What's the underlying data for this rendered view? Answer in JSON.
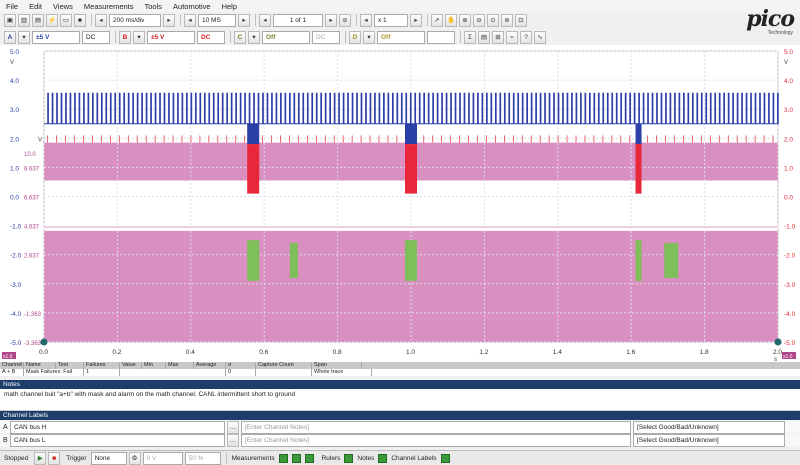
{
  "menu": [
    "File",
    "Edit",
    "Views",
    "Measurements",
    "Tools",
    "Automotive",
    "Help"
  ],
  "logo": {
    "word": "pico",
    "sub": "Technology"
  },
  "toolbar": {
    "timebase": "200 ms/div",
    "samples": "10 MS",
    "buffer": "1 of 1",
    "zoom": "x 1"
  },
  "channels": {
    "a": {
      "label": "A",
      "range": "±5 V",
      "coupling": "DC"
    },
    "b": {
      "label": "B",
      "range": "±5 V",
      "coupling": "DC"
    },
    "c": {
      "label": "C",
      "state": "Off"
    },
    "d": {
      "label": "D",
      "state": "Off"
    },
    "c_coupling": "DC"
  },
  "scope": {
    "left_axis_a": [
      "5.0",
      "4.0",
      "3.0",
      "2.0",
      "1.0",
      "0.0",
      "-1.0",
      "-2.0",
      "-3.0",
      "-4.0",
      "-5.0"
    ],
    "left_axis_math": [
      "10.0",
      "8.637",
      "6.637",
      "4.637",
      "2.637",
      "-1.363",
      "-3.363"
    ],
    "right_axis": [
      "5.0",
      "4.0",
      "3.0",
      "2.0",
      "1.0",
      "0.0",
      "-1.0",
      "-2.0",
      "-3.0",
      "-4.0",
      "-5.0"
    ],
    "unit_v": "V",
    "x_axis": [
      "0.0",
      "0.2",
      "0.4",
      "0.6",
      "0.8",
      "1.0",
      "1.2",
      "1.4",
      "1.6",
      "1.8",
      "2.0"
    ],
    "x_unit": "s",
    "ruler_left": "x1.0",
    "ruler_right": "x1.0"
  },
  "measurements": {
    "headers": [
      "Channel",
      "Name",
      "Test",
      "Failures",
      "Value",
      "Min",
      "Max",
      "Average",
      "σ",
      "Capture Count",
      "Span"
    ],
    "row": [
      "A + B",
      "Mask Failures: Fail",
      "",
      "1",
      "",
      "",
      "",
      "",
      "0",
      "",
      "Whole trace"
    ]
  },
  "notes": {
    "title": "Notes",
    "text": "math channel buit \"a+b\" with mask and alarm on the math channel. CANL intermittent short to ground"
  },
  "channel_labels": {
    "title": "Channel Labels",
    "rows": [
      {
        "ch": "A",
        "name": "CAN bus H",
        "notes_placeholder": "[Enter Channel Notes]",
        "status": "[Select Good/Bad/Unknown]"
      },
      {
        "ch": "B",
        "name": "CAN bus L",
        "notes_placeholder": "[Enter Channel Notes]",
        "status": "[Select Good/Bad/Unknown]"
      }
    ]
  },
  "status": {
    "state": "Stopped",
    "trigger_label": "Trigger",
    "trigger_mode": "None",
    "trigger_level": "0 V",
    "trigger_pos": "50 %",
    "measurements": "Measurements",
    "rulers": "Rulers",
    "notes": "Notes",
    "channel_labels": "Channel Labels"
  },
  "colors": {
    "channel_a": "#2b3fa8",
    "channel_b": "#e8283a",
    "math": "#d98fbf",
    "mask_fail": "#7fbf5a"
  }
}
